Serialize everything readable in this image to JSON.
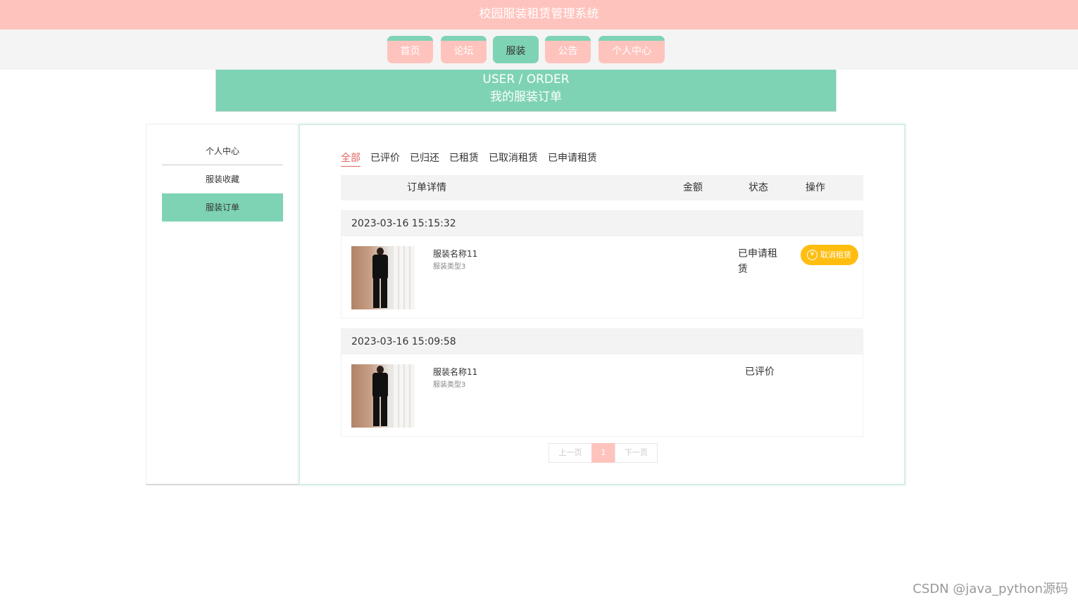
{
  "header": {
    "title": "校园服装租赁管理系统"
  },
  "nav": {
    "items": [
      {
        "label": "首页",
        "active": false
      },
      {
        "label": "论坛",
        "active": false
      },
      {
        "label": "服装",
        "active": true
      },
      {
        "label": "公告",
        "active": false
      },
      {
        "label": "个人中心",
        "active": false
      }
    ]
  },
  "banner": {
    "en": "USER / ORDER",
    "cn": "我的服装订单"
  },
  "sidebar": {
    "items": [
      {
        "label": "个人中心"
      },
      {
        "label": "服装收藏"
      },
      {
        "label": "服装订单",
        "active": true
      }
    ]
  },
  "tabs": [
    "全部",
    "已评价",
    "已归还",
    "已租赁",
    "已取消租赁",
    "已申请租赁"
  ],
  "active_tab": "全部",
  "table": {
    "headers": {
      "detail": "订单详情",
      "amount": "金额",
      "status": "状态",
      "action": "操作"
    }
  },
  "orders": [
    {
      "time": "2023-03-16 15:15:32",
      "name": "服装名称11",
      "type": "服装类型3",
      "status_line1": "已申请租",
      "status_line2": "赁",
      "action": "取消租赁",
      "action_icon": "¥"
    },
    {
      "time": "2023-03-16 15:09:58",
      "name": "服装名称11",
      "type": "服装类型3",
      "status_line1": "已评价",
      "status_line2": ""
    }
  ],
  "pager": {
    "prev": "上一页",
    "current": "1",
    "next": "下一页"
  },
  "watermark": "CSDN @java_python源码",
  "colors": {
    "pink": "#ffc3bd",
    "green": "#7ed3b4",
    "orange": "#ffbd10",
    "red": "#e06560"
  }
}
